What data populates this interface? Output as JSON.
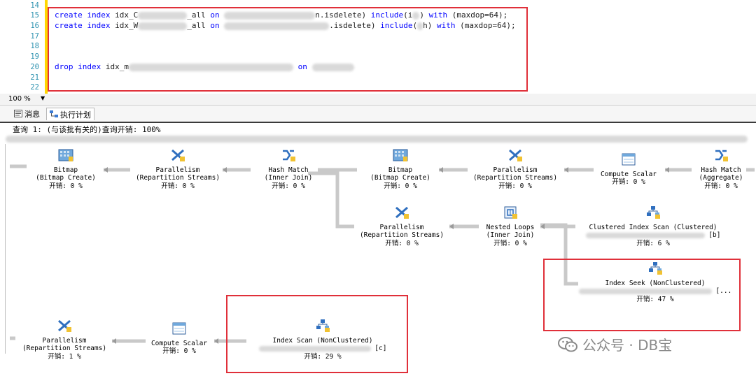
{
  "editor": {
    "line_numbers": [
      "14",
      "15",
      "16",
      "17",
      "18",
      "19",
      "20",
      "21",
      "22"
    ],
    "line15": {
      "kw1": "create",
      "kw2": "index",
      "name": "idx_C",
      "mid": "_all",
      "kw3": "on",
      "tail": "n.isdelete)",
      "kw4": "include",
      "arg": "(i",
      "kw5": "with",
      "opt": "(maxdop=64);"
    },
    "line16": {
      "kw1": "create",
      "kw2": "index",
      "name": "idx_W",
      "mid": "_all",
      "kw3": "on",
      "tail": ".isdelete)",
      "kw4": "include",
      "arg": "(",
      "argtail": "h)",
      "kw5": "with",
      "opt": "(maxdop=64);"
    },
    "line20": {
      "kw1": "drop",
      "kw2": "index",
      "name": "idx_m",
      "kw3": "on"
    }
  },
  "zoom": {
    "value": "100 %"
  },
  "tabs": [
    {
      "label": "消息",
      "icon": "messages-icon"
    },
    {
      "label": "执行计划",
      "icon": "execution-plan-icon"
    }
  ],
  "query_title": "查询 1: (与该批有关的)查询开销: 100%",
  "operators": {
    "bitmap1": {
      "name": "Bitmap",
      "sub": "(Bitmap Create)",
      "cost": "开销: 0 %",
      "icon": "bitmap-icon"
    },
    "parallel1": {
      "name": "Parallelism",
      "sub": "(Repartition Streams)",
      "cost": "开销: 0 %",
      "icon": "parallelism-icon"
    },
    "hashjoin": {
      "name": "Hash Match",
      "sub": "(Inner Join)",
      "cost": "开销: 0 %",
      "icon": "hash-match-icon"
    },
    "bitmap2": {
      "name": "Bitmap",
      "sub": "(Bitmap Create)",
      "cost": "开销: 0 %",
      "icon": "bitmap-icon"
    },
    "parallel2": {
      "name": "Parallelism",
      "sub": "(Repartition Streams)",
      "cost": "开销: 0 %",
      "icon": "parallelism-icon"
    },
    "compute1": {
      "name": "Compute Scalar",
      "cost": "开销: 0 %",
      "icon": "compute-scalar-icon"
    },
    "hashagg": {
      "name": "Hash Match",
      "sub": "(Aggregate)",
      "cost": "开销: 0 %",
      "icon": "hash-match-icon"
    },
    "parallel3": {
      "name": "Parallelism",
      "sub": "(Repartition Streams)",
      "cost": "开销: 0 %",
      "icon": "parallelism-icon"
    },
    "nested": {
      "name": "Nested Loops",
      "sub": "(Inner Join)",
      "cost": "开销: 0 %",
      "icon": "nested-loops-icon"
    },
    "clustered": {
      "name": "Clustered Index Scan (Clustered)",
      "sub": "[b]",
      "cost": "开销: 6 %",
      "icon": "clustered-index-scan-icon"
    },
    "seek": {
      "name": "Index Seek (NonClustered)",
      "sub": "[...",
      "cost": "开销: 47 %",
      "icon": "index-seek-icon"
    },
    "parallel4": {
      "name": "Parallelism",
      "sub": "(Repartition Streams)",
      "cost": "开销: 1 %",
      "icon": "parallelism-icon"
    },
    "compute2": {
      "name": "Compute Scalar",
      "cost": "开销: 0 %",
      "icon": "compute-scalar-icon"
    },
    "scan": {
      "name": "Index Scan (NonClustered)",
      "sub": "[c]",
      "cost": "开销: 29 %",
      "icon": "index-scan-icon"
    }
  },
  "watermark": {
    "text": "公众号 · DB宝",
    "icon": "wechat-icon"
  },
  "colors": {
    "keyword": "#0000ff",
    "highlight": "#e0303a",
    "gutter": "#ffd700"
  }
}
